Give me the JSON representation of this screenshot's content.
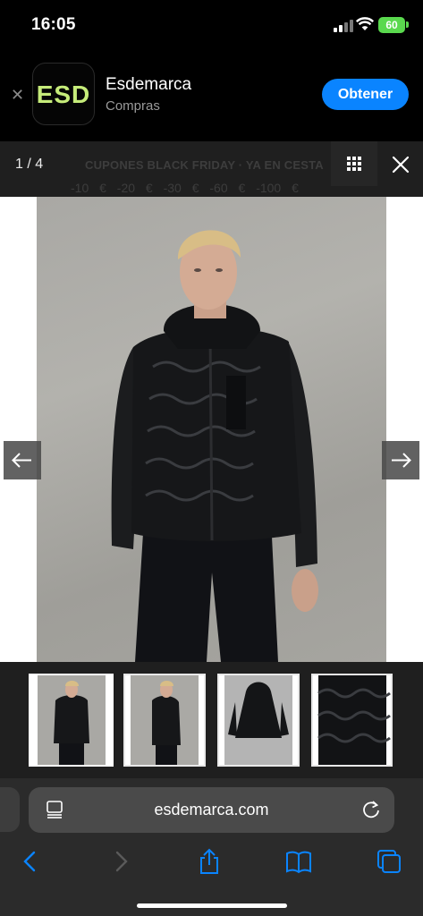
{
  "status_bar": {
    "time": "16:05",
    "battery_level": "60",
    "battery_color": "#5ad94e"
  },
  "app_banner": {
    "icon_text": "ESD",
    "icon_color": "#c6ec7a",
    "app_name": "Esdemarca",
    "category": "Compras",
    "get_label": "Obtener",
    "get_color": "#0a84ff"
  },
  "gallery": {
    "counter": "1 / 4",
    "promo_text": "CUPONES BLACK FRIDAY · YA EN CESTA",
    "promo_values": "-10 € -20 € -30 € -60 € -100 €",
    "current_index": 1,
    "total_images": 4,
    "main_image": "man-wearing-black-quilted-hooded-jacket",
    "thumbnails": [
      {
        "subject": "jacket-front-worn",
        "active": true
      },
      {
        "subject": "jacket-side-worn",
        "active": false
      },
      {
        "subject": "jacket-hanging-back",
        "active": false
      },
      {
        "subject": "jacket-detail-closeup",
        "active": false
      }
    ]
  },
  "browser": {
    "url": "esdemarca.com",
    "toolbar": [
      "back-icon",
      "forward-icon",
      "share-icon",
      "bookmarks-icon",
      "tabs-icon"
    ],
    "accent_color": "#0a84ff"
  }
}
